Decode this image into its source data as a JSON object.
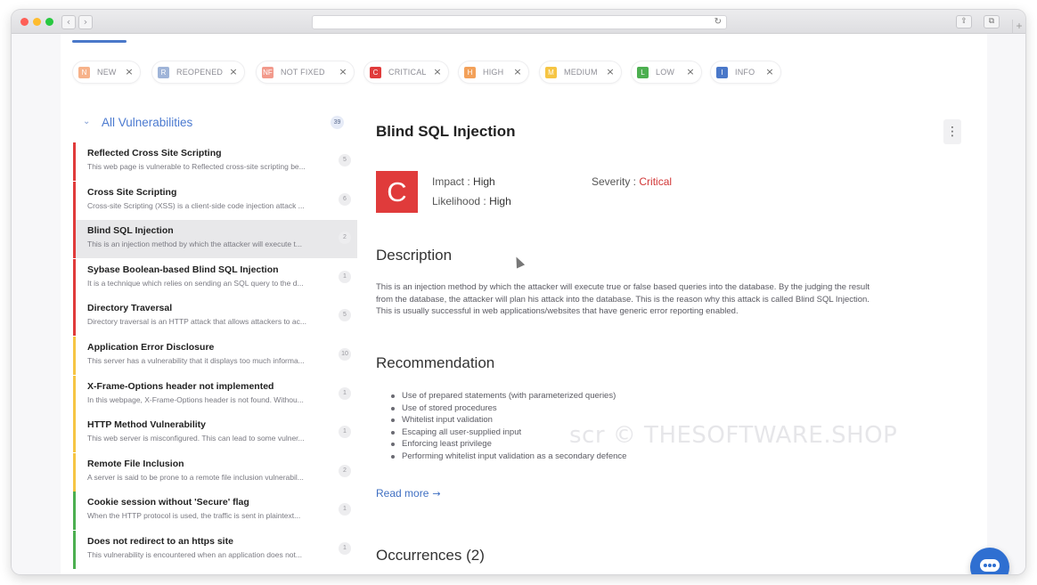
{
  "filters": [
    {
      "abbr": "N",
      "label": "NEW",
      "color": "#f7b28a"
    },
    {
      "abbr": "R",
      "label": "REOPENED",
      "color": "#9fb4d8"
    },
    {
      "abbr": "NF",
      "label": "NOT FIXED",
      "color": "#f29a8c"
    },
    {
      "abbr": "C",
      "label": "CRITICAL",
      "color": "#e03b3b"
    },
    {
      "abbr": "H",
      "label": "HIGH",
      "color": "#f3a15a"
    },
    {
      "abbr": "M",
      "label": "MEDIUM",
      "color": "#f6c544"
    },
    {
      "abbr": "L",
      "label": "LOW",
      "color": "#4caf50"
    },
    {
      "abbr": "I",
      "label": "INFO",
      "color": "#4a78c9"
    }
  ],
  "close_glyph": "×",
  "sidebar": {
    "title": "All Vulnerabilities",
    "count": "39",
    "items": [
      {
        "title": "Reflected Cross Site Scripting",
        "desc": "This web page is vulnerable to Reflected cross-site scripting be...",
        "count": "5",
        "severity": "critical"
      },
      {
        "title": "Cross Site Scripting",
        "desc": "Cross-site Scripting (XSS) is a client-side code injection attack ...",
        "count": "6",
        "severity": "critical"
      },
      {
        "title": "Blind SQL Injection",
        "desc": "This is an injection method by which the attacker will execute t...",
        "count": "2",
        "severity": "critical"
      },
      {
        "title": "Sybase Boolean-based Blind SQL Injection",
        "desc": "It is a technique which relies on sending an SQL query to the d...",
        "count": "1",
        "severity": "critical"
      },
      {
        "title": "Directory Traversal",
        "desc": "Directory traversal is an HTTP attack that allows attackers to ac...",
        "count": "5",
        "severity": "critical"
      },
      {
        "title": "Application Error Disclosure",
        "desc": "This server has a vulnerability that it displays too much informa...",
        "count": "10",
        "severity": "medium"
      },
      {
        "title": "X-Frame-Options header not implemented",
        "desc": "In this webpage, X-Frame-Options header is not found. Withou...",
        "count": "1",
        "severity": "medium"
      },
      {
        "title": "HTTP Method Vulnerability",
        "desc": "This web server is misconfigured. This can lead to some vulner...",
        "count": "1",
        "severity": "medium"
      },
      {
        "title": "Remote File Inclusion",
        "desc": "A server is said to be prone to a remote file inclusion vulnerabil...",
        "count": "2",
        "severity": "medium"
      },
      {
        "title": "Cookie session without 'Secure' flag",
        "desc": "When the HTTP protocol is used, the traffic is sent in plaintext...",
        "count": "1",
        "severity": "low"
      },
      {
        "title": "Does not redirect to an https site",
        "desc": "This vulnerability is encountered when an application does not...",
        "count": "1",
        "severity": "low"
      }
    ]
  },
  "severity_colors": {
    "critical": "#e03b3b",
    "medium": "#f6c544",
    "low": "#4caf50"
  },
  "detail": {
    "title": "Blind SQL Injection",
    "badge": "C",
    "impact_label": "Impact :",
    "impact_value": "High",
    "likelihood_label": "Likelihood :",
    "likelihood_value": "High",
    "severity_label": "Severity :",
    "severity_value": "Critical",
    "description_heading": "Description",
    "description": "This is an injection method by which the attacker will execute true or false based queries into the database. By the judging the result from the database, the attacker will plan his attack into the database. This is the reason why this attack is called Blind SQL Injection. This is usually successful in web applications/websites that have generic error reporting enabled.",
    "recommendation_heading": "Recommendation",
    "recommendations": [
      "Use of prepared statements (with parameterized queries)",
      "Use of stored procedures",
      "Whitelist input validation",
      "Escaping all user-supplied input",
      "Enforcing least privilege",
      "Performing whitelist input validation as a secondary defence"
    ],
    "read_more": "Read more",
    "occurrences_heading": "Occurrences (2)"
  },
  "watermark": "scr © THESOFTWARE.SHOP"
}
